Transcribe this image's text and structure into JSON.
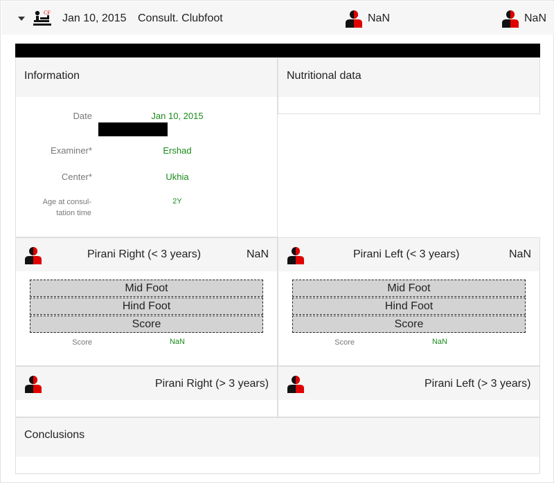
{
  "header": {
    "date": "Jan 10, 2015",
    "title": "Consult. Clubfoot",
    "icon_badge": "CF",
    "right_value_1": "NaN",
    "right_value_2": "NaN"
  },
  "information": {
    "title": "Information",
    "fields": {
      "date_label": "Date",
      "date_value": "Jan 10, 2015",
      "examiner_label": "Examiner*",
      "examiner_value": "Ershad",
      "center_label": "Center*",
      "center_value": "Ukhia",
      "age_label_line1": "Age at consul-",
      "age_label_line2": "tation time",
      "age_value": "2Y"
    }
  },
  "nutritional": {
    "title": "Nutritional data"
  },
  "pirani_right_lt3": {
    "title": "Pirani Right (< 3 years)",
    "value": "NaN",
    "rows": [
      "Mid Foot",
      "Hind Foot",
      "Score"
    ],
    "score_label": "Score",
    "score_value": "NaN"
  },
  "pirani_left_lt3": {
    "title": "Pirani Left (< 3 years)",
    "value": "NaN",
    "rows": [
      "Mid Foot",
      "Hind Foot",
      "Score"
    ],
    "score_label": "Score",
    "score_value": "NaN"
  },
  "pirani_right_gt3": {
    "title": "Pirani Right (> 3 years)"
  },
  "pirani_left_gt3": {
    "title": "Pirani Left (> 3 years)"
  },
  "conclusions": {
    "title": "Conclusions"
  },
  "colors": {
    "accent_red": "#e00000",
    "value_green": "#1a8a1a",
    "header_bg": "#f6f6f6"
  },
  "icons": {
    "person": "person-half-red-icon",
    "clubfoot": "clubfoot-consult-icon",
    "caret": "caret-down-icon"
  }
}
